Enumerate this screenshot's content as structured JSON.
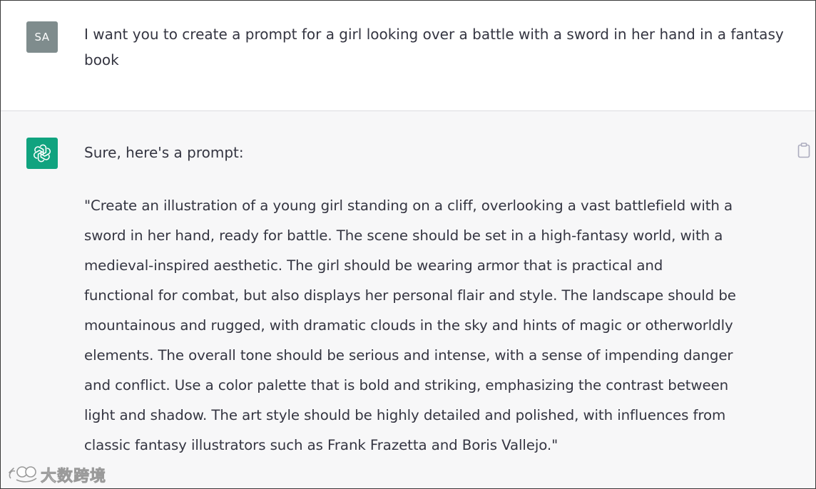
{
  "user_message": {
    "avatar_initials": "SA",
    "text": "I want you to create a prompt for a girl looking over a battle with a sword in her hand in a fantasy book"
  },
  "assistant_message": {
    "avatar_icon": "openai-logo-icon",
    "intro": "Sure, here's a prompt:",
    "body_lines": [
      "\"Create an illustration of a young girl standing on a cliff, overlooking a vast battlefield with a",
      "sword in her hand, ready for battle. The scene should be set in a high-fantasy world, with a",
      "medieval-inspired aesthetic. The girl should be wearing armor that is practical and",
      "functional for combat, but also displays her personal flair and style. The landscape should be",
      "mountainous and rugged, with dramatic clouds in the sky and hints of magic or otherworldly",
      "elements. The overall tone should be serious and intense, with a sense of impending danger",
      "and conflict. Use a color palette that is bold and striking, emphasizing the contrast between",
      "light and shadow. The art style should be highly detailed and polished, with influences from",
      "classic fantasy illustrators such as Frank Frazetta and Boris Vallejo.\""
    ],
    "copy_icon": "clipboard-icon"
  },
  "watermark": {
    "text": "大数跨境",
    "icon": "watermark-logo-icon"
  },
  "colors": {
    "user_avatar_bg": "#7f8c8d",
    "bot_avatar_bg": "#10a37f",
    "assistant_bg": "#f7f7f8",
    "text": "#343541"
  }
}
